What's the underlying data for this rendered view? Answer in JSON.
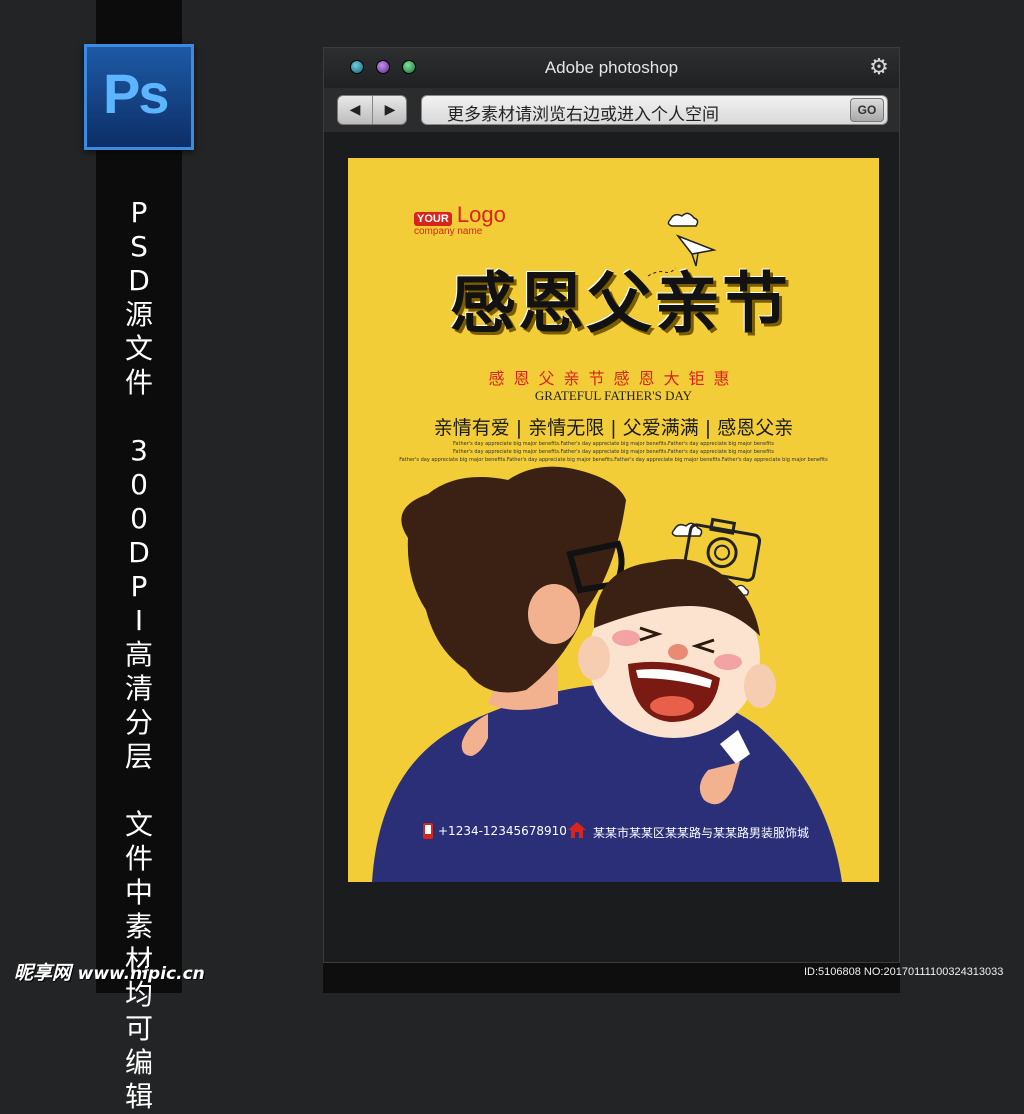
{
  "app_icon": {
    "label": "Ps"
  },
  "side_text": [
    "PSD源文件",
    "300DPI高清分层",
    "文件中素材均可编辑"
  ],
  "window": {
    "title": "Adobe photoshop",
    "url_text": "更多素材请浏览右边或进入个人空间",
    "go_label": "GO",
    "back_glyph": "◀",
    "forward_glyph": "▶"
  },
  "poster": {
    "logo_badge": "YOUR",
    "logo_word": "Logo",
    "logo_company": "company name",
    "headline": "感恩父亲节",
    "subtitle_cn": "感恩父亲节感恩大钜惠",
    "subtitle_en": "GRATEFUL FATHER'S DAY",
    "slogan": "亲情有爱 | 亲情无限 | 父爱满满 | 感恩父亲",
    "small_lines": [
      "Father's day appreciate big major benefits.Father's day appreciate big major benefits.Father's day appreciate big major benefits",
      "Father's day appreciate big major benefits.Father's day appreciate big major benefits.Father's day appreciate big major benefits",
      "Father's day appreciate big major benefits.Father's day appreciate big major benefits.Father's day appreciate big major benefits.Father's day appreciate big major benefits"
    ],
    "phone": "+1234-12345678910",
    "address": "某某市某某区某某路与某某路男装服饰城"
  },
  "watermark": {
    "site_cn": "昵享网",
    "site_url": "www.nipic.cn",
    "id_text": "ID:5106808 NO:20170111100324313033"
  },
  "colors": {
    "poster_bg": "#f2cd38",
    "accent_red": "#d9241c",
    "shirt_navy": "#2a2f78"
  }
}
